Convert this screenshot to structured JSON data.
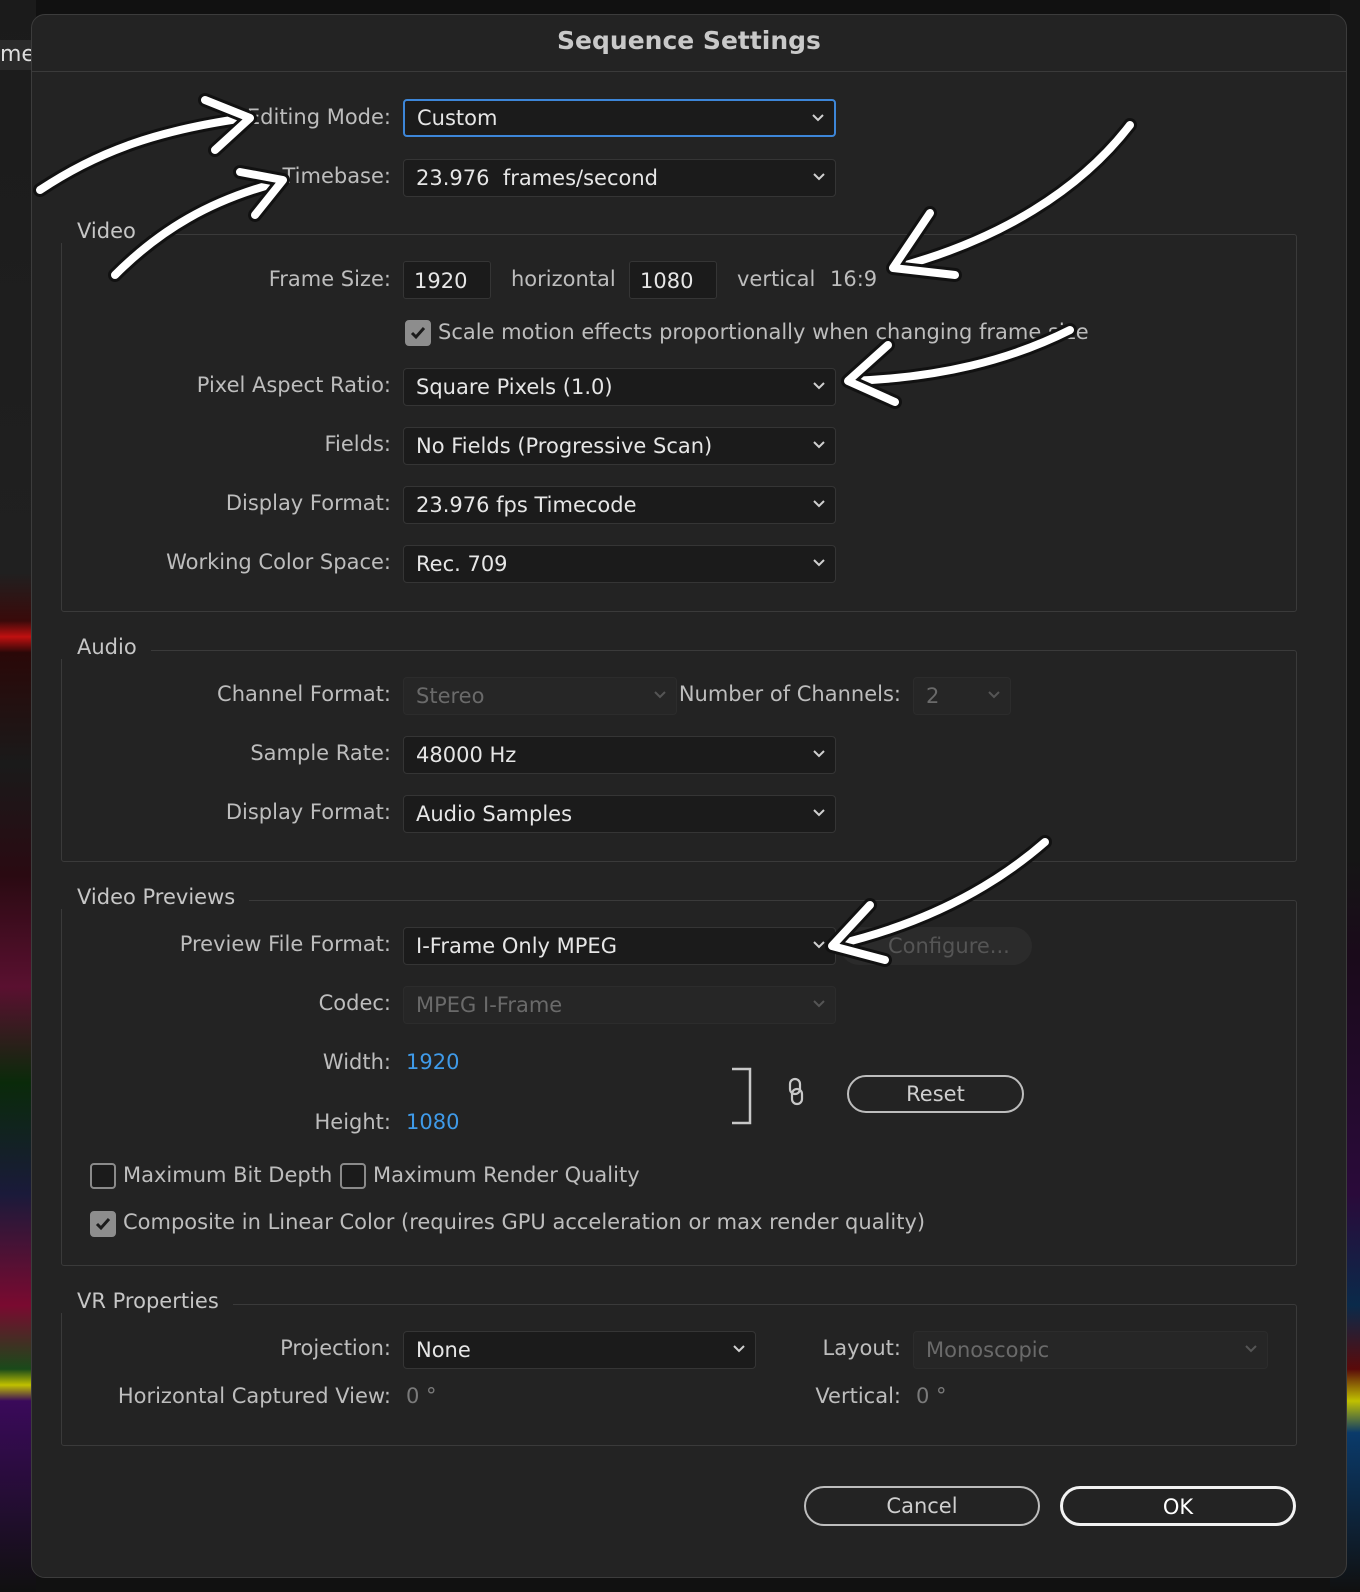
{
  "background": {
    "tab_fragment": "me"
  },
  "dialog": {
    "title": "Sequence Settings"
  },
  "general": {
    "editing_mode": {
      "label": "Editing Mode:",
      "value": "Custom"
    },
    "timebase": {
      "label": "Timebase:",
      "value": "23.976  frames/second"
    }
  },
  "video": {
    "title": "Video",
    "frame_size": {
      "label": "Frame Size:",
      "width": "1920",
      "horizontal_label": "horizontal",
      "height": "1080",
      "vertical_label": "vertical",
      "aspect": "16:9"
    },
    "scale_motion": {
      "label": "Scale motion effects proportionally when changing frame size",
      "checked": true
    },
    "pixel_aspect_ratio": {
      "label": "Pixel Aspect Ratio:",
      "value": "Square Pixels (1.0)"
    },
    "fields": {
      "label": "Fields:",
      "value": "No Fields (Progressive Scan)"
    },
    "display_format": {
      "label": "Display Format:",
      "value": "23.976 fps Timecode"
    },
    "working_color_space": {
      "label": "Working Color Space:",
      "value": "Rec. 709"
    }
  },
  "audio": {
    "title": "Audio",
    "channel_format": {
      "label": "Channel Format:",
      "value": "Stereo"
    },
    "number_of_channels": {
      "label": "Number of Channels:",
      "value": "2"
    },
    "sample_rate": {
      "label": "Sample Rate:",
      "value": "48000 Hz"
    },
    "display_format": {
      "label": "Display Format:",
      "value": "Audio Samples"
    }
  },
  "video_previews": {
    "title": "Video Previews",
    "preview_file_format": {
      "label": "Preview File Format:",
      "value": "I-Frame Only MPEG"
    },
    "configure_label": "Configure...",
    "codec": {
      "label": "Codec:",
      "value": "MPEG I-Frame"
    },
    "width": {
      "label": "Width:",
      "value": "1920"
    },
    "height": {
      "label": "Height:",
      "value": "1080"
    },
    "reset_label": "Reset",
    "max_bit_depth": {
      "label": "Maximum Bit Depth",
      "checked": false
    },
    "max_render_quality": {
      "label": "Maximum Render Quality",
      "checked": false
    },
    "composite_linear": {
      "label": "Composite in Linear Color (requires GPU acceleration or max render quality)",
      "checked": true
    }
  },
  "vr": {
    "title": "VR Properties",
    "projection": {
      "label": "Projection:",
      "value": "None"
    },
    "layout": {
      "label": "Layout:",
      "value": "Monoscopic"
    },
    "horizontal_view": {
      "label": "Horizontal Captured View:",
      "value": "0 °"
    },
    "vertical": {
      "label": "Vertical:",
      "value": "0 °"
    }
  },
  "footer": {
    "cancel_label": "Cancel",
    "ok_label": "OK"
  },
  "colors": {
    "accent": "#3d86d8",
    "link_value": "#3f9ae8",
    "dialog_bg": "#232323"
  }
}
